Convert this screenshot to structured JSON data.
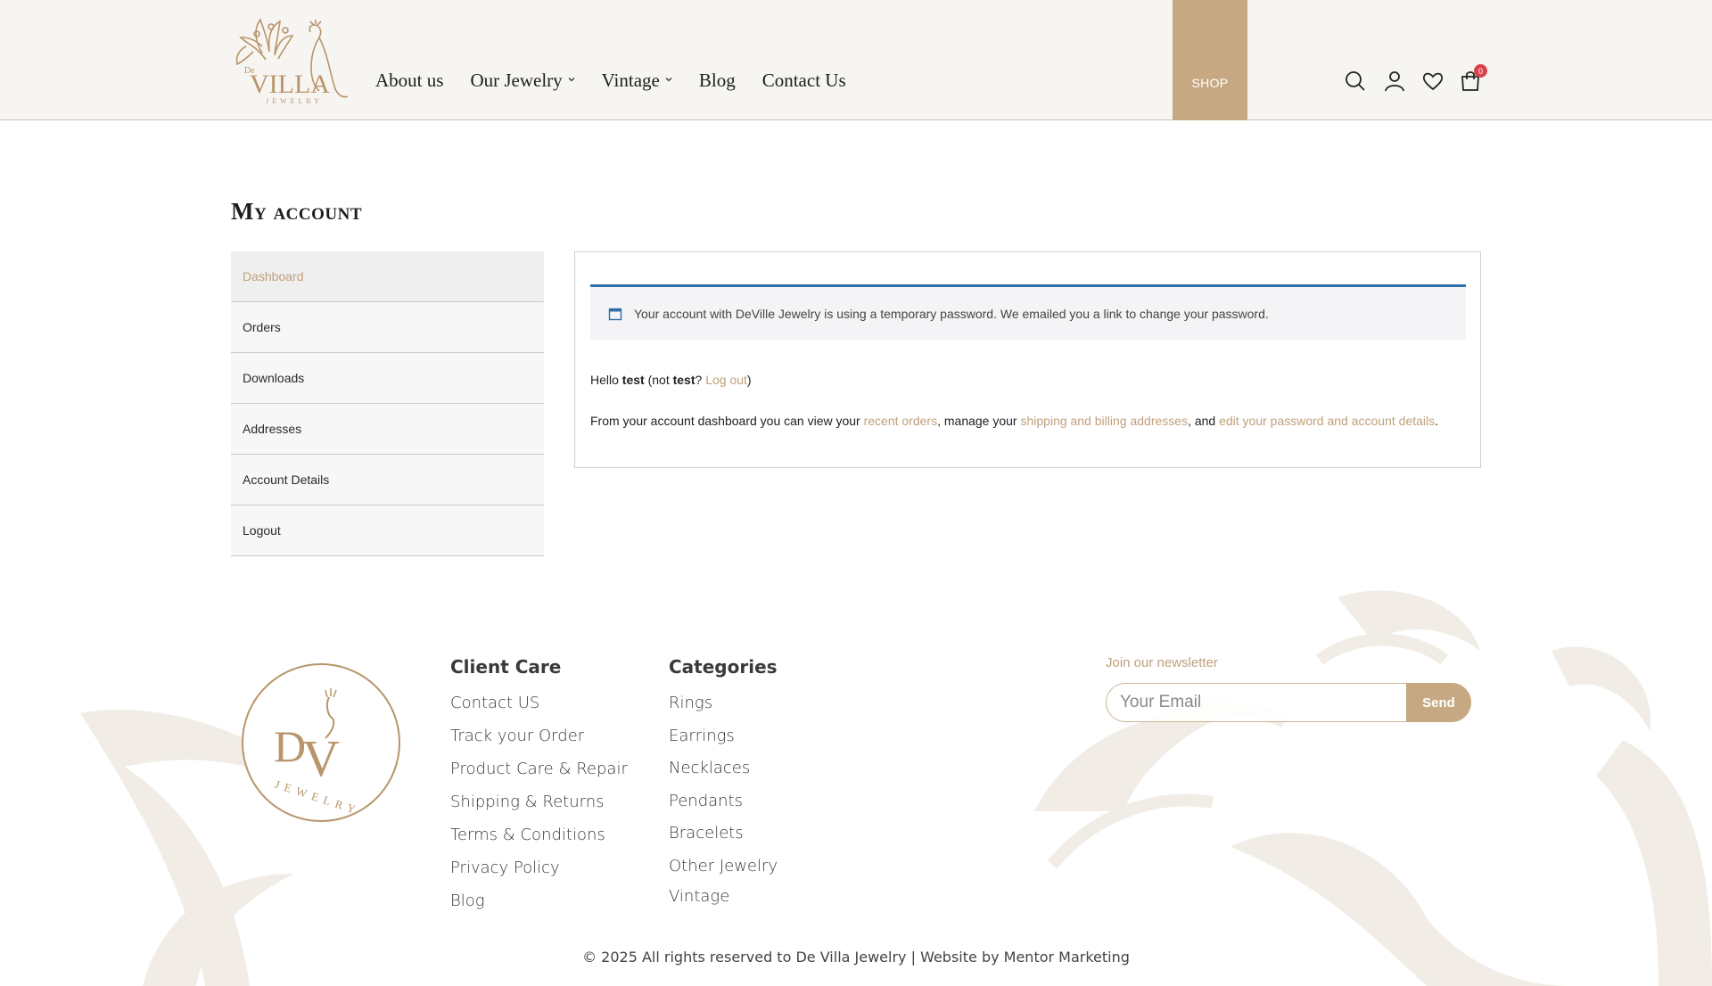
{
  "header": {
    "logo_alt": "De Villa Jewelry",
    "nav": [
      {
        "label": "About us",
        "has_dropdown": false
      },
      {
        "label": "Our Jewelry",
        "has_dropdown": true
      },
      {
        "label": "Vintage",
        "has_dropdown": true
      },
      {
        "label": "Blog",
        "has_dropdown": false
      },
      {
        "label": "Contact Us",
        "has_dropdown": false
      }
    ],
    "shop_label": "SHOP",
    "icons": [
      "search-icon",
      "user-icon",
      "heart-icon",
      "cart-icon"
    ],
    "cart_count": "0"
  },
  "account": {
    "title": "My account",
    "side_nav": [
      {
        "label": "Dashboard",
        "active": true
      },
      {
        "label": "Orders",
        "active": false
      },
      {
        "label": "Downloads",
        "active": false
      },
      {
        "label": "Addresses",
        "active": false
      },
      {
        "label": "Account Details",
        "active": false
      },
      {
        "label": "Logout",
        "active": false
      }
    ],
    "notice": "Your account with DeVille Jewelry is using a temporary password. We emailed you a link to change your password.",
    "hello": {
      "prefix": "Hello ",
      "user": "test",
      "mid": " (not ",
      "user2": "test",
      "q": "? ",
      "logout": "Log out",
      "suffix": ")"
    },
    "desc": {
      "p1": "From your account dashboard you can view your ",
      "l1": "recent orders",
      "p2": ", manage your ",
      "l2": "shipping and billing addresses",
      "p3": ", and ",
      "l3": "edit your password and account details",
      "p4": "."
    }
  },
  "footer": {
    "client_care": {
      "title": "Client Care",
      "links": [
        "Contact US",
        "Track your Order",
        "Product Care & Repair",
        "Shipping & Returns",
        "Terms & Conditions",
        "Privacy Policy",
        "Blog"
      ]
    },
    "categories": {
      "title": "Categories",
      "links": [
        "Rings",
        "Earrings",
        "Necklaces",
        "Pendants",
        "Bracelets",
        "Other Jewelry",
        "Vintage"
      ]
    },
    "newsletter": {
      "label": "Join our newsletter",
      "placeholder": "Your Email",
      "button": "Send"
    },
    "copyright": "© 2025 All rights reserved to De Villa Jewelry | Website by Mentor Marketing"
  },
  "colors": {
    "accent": "#c6a982",
    "link": "#bfa07d",
    "notice_border": "#2d6fa9",
    "badge": "#d9424a"
  }
}
